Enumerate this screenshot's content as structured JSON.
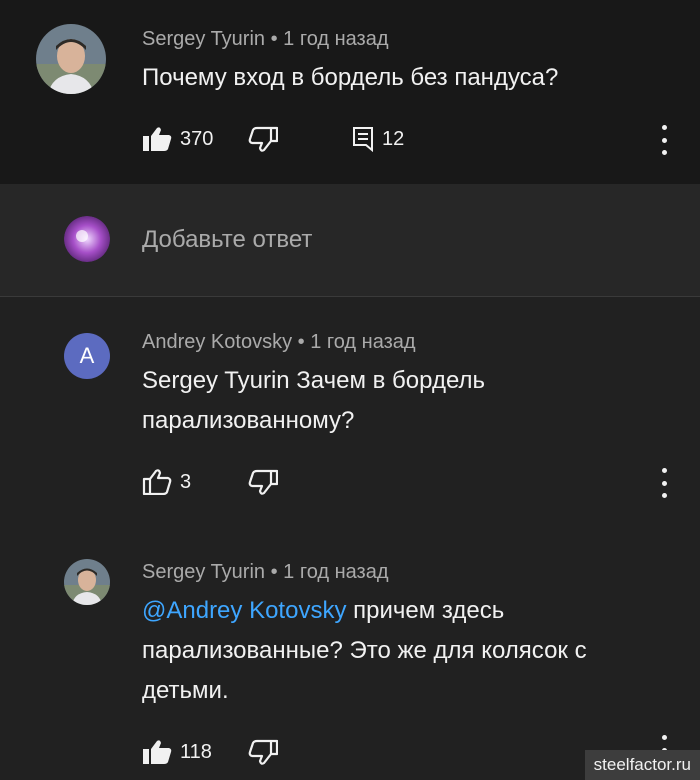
{
  "comment": {
    "author": "Sergey Tyurin",
    "time": "• 1 год назад",
    "text": "Почему вход в бордель без пандуса?",
    "likes": "370",
    "replies": "12"
  },
  "add_reply": {
    "placeholder": "Добавьте ответ"
  },
  "reply1": {
    "avatar_letter": "A",
    "author": "Andrey Kotovsky",
    "time": "• 1 год назад",
    "text_line1": "Sergey Tyurin Зачем в бордель",
    "text_line2": "парализованному?",
    "likes": "3"
  },
  "reply2": {
    "author": "Sergey Tyurin",
    "time": "• 1 год назад",
    "mention": "@Andrey Kotovsky",
    "text_line1_rest": " причем здесь",
    "text_line2": "парализованные? Это же для колясок с",
    "text_line3": "детьми.",
    "likes": "118"
  },
  "watermark": "steelfactor.ru",
  "colors": {
    "background": "#212121",
    "top_background": "#181818",
    "reply_box_background": "#272727",
    "mention": "#3ea6ff",
    "letter_avatar": "#5c6bc0"
  }
}
